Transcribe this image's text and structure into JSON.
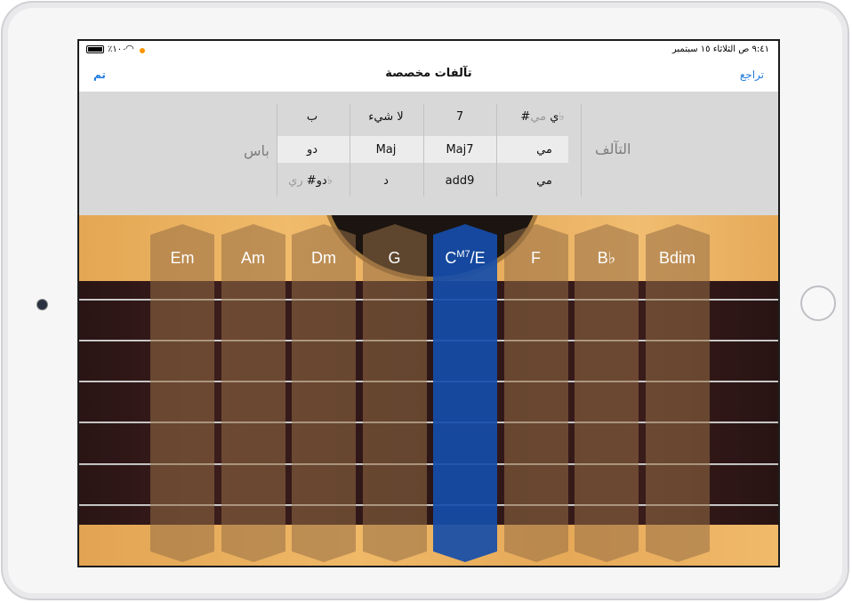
{
  "status_bar": {
    "time": "٩:٤١ ص   الثلاثاء ١٥ سبتمبر",
    "battery": "٪١٠٠",
    "wifi_icon": "wifi-icon",
    "recording_color": "#ff9500"
  },
  "nav": {
    "title": "تآلفات مخصصة",
    "back_label": "تراجع",
    "done_label": "تم"
  },
  "picker": {
    "chord_label": "التآلف",
    "bass_label": "باس",
    "chord_root": {
      "top": "#ي",
      "top_faded": "مي♭",
      "selected": "مي",
      "bottom": "مي"
    },
    "extension": {
      "top": "7",
      "selected": "Maj7",
      "bottom": "add9"
    },
    "quality": {
      "top": "لا شيء",
      "selected": "Maj",
      "bottom": "د"
    },
    "bass": {
      "top": "ب",
      "selected": "دو",
      "bottom": "دو#",
      "bottom_faded": "ري♭"
    }
  },
  "chords": [
    {
      "label": "Em",
      "selected": false
    },
    {
      "label": "Am",
      "selected": false
    },
    {
      "label": "Dm",
      "selected": false
    },
    {
      "label": "G",
      "selected": false
    },
    {
      "label": "C",
      "sup": "M7",
      "suffix": "/E",
      "selected": true
    },
    {
      "label": "F",
      "selected": false
    },
    {
      "label": "B♭",
      "selected": false
    },
    {
      "label": "Bdim",
      "selected": false
    }
  ],
  "colors": {
    "accent_blue": "#1f7ae0",
    "selected_chord": "#154daa",
    "wood": "#e7ad5c"
  }
}
